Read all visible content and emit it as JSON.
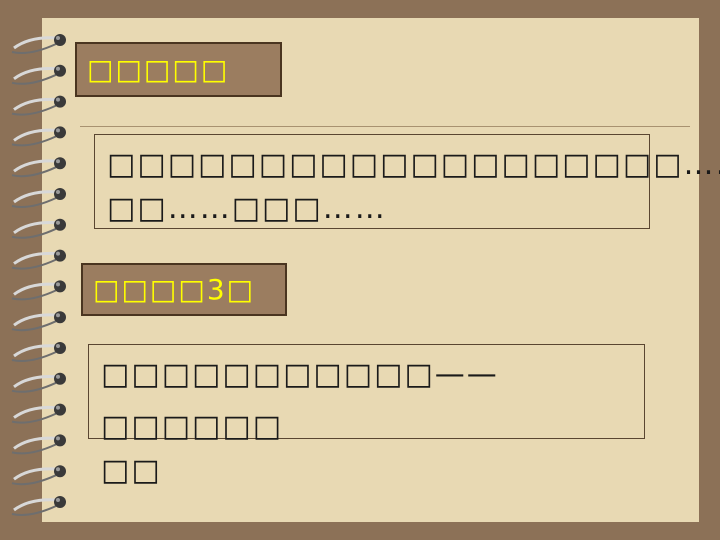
{
  "section1": {
    "label": "□□□□□",
    "body_lines": [
      "□□□□□□□□□□□□□□□□□□□……",
      "□□……□□□……"
    ]
  },
  "section2": {
    "label": "□□□□3□",
    "body_lines": [
      "□□□□□□□□□□□——□□□□□□",
      "□□"
    ]
  },
  "colors": {
    "frame": "#8c7157",
    "paper": "#e8d9b3",
    "label_bg": "#9b7d60",
    "label_text": "#ffff00"
  }
}
